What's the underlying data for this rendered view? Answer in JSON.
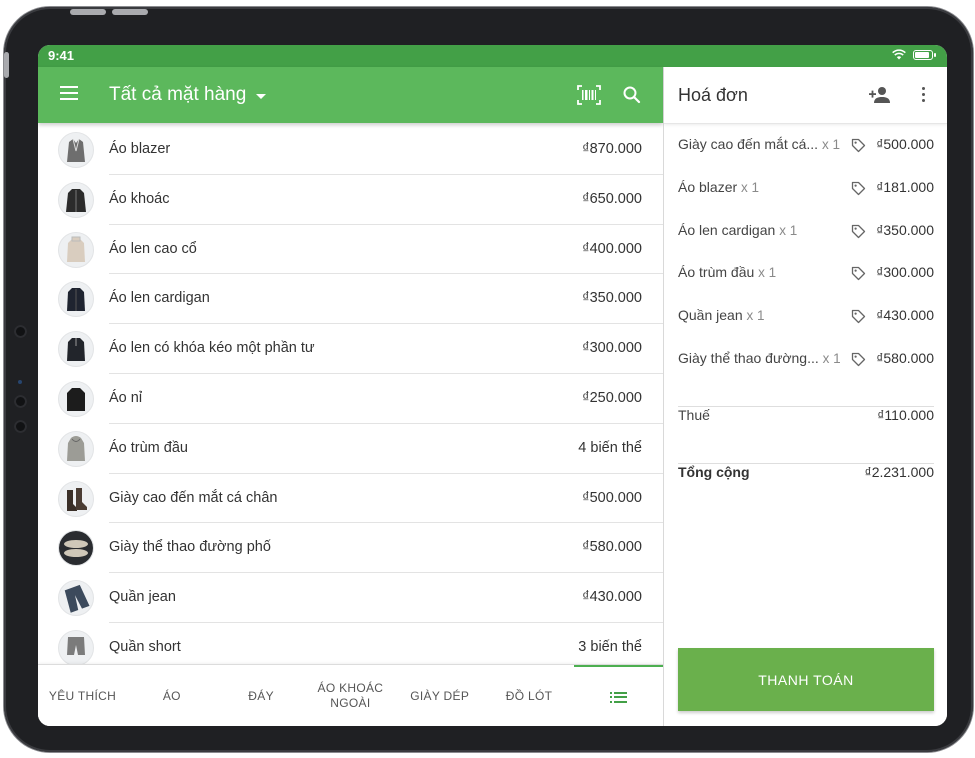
{
  "status_bar": {
    "time": "9:41",
    "battery_level": 0.9
  },
  "app_bar": {
    "title": "Tất cả mặt hàng",
    "icons": [
      "menu-icon",
      "chevron-down-icon",
      "barcode-scan-icon",
      "search-icon"
    ]
  },
  "items": [
    {
      "name": "Áo blazer",
      "price": "₫870.000",
      "icon": "blazer",
      "color": "#6e6e6e"
    },
    {
      "name": "Áo khoác",
      "price": "₫650.000",
      "icon": "jacket",
      "color": "#2b2b2b"
    },
    {
      "name": "Áo len cao cổ",
      "price": "₫400.000",
      "icon": "sweater",
      "color": "#d9cdbf"
    },
    {
      "name": "Áo len cardigan",
      "price": "₫350.000",
      "icon": "cardigan",
      "color": "#1f2430"
    },
    {
      "name": "Áo len có khóa kéo một phần tư",
      "price": "₫300.000",
      "icon": "zip-sweater",
      "color": "#22252b"
    },
    {
      "name": "Áo nỉ",
      "price": "₫250.000",
      "icon": "sweatshirt",
      "color": "#1c1c1c"
    },
    {
      "name": "Áo trùm đầu",
      "price": "4 biến thể",
      "icon": "hoodie",
      "color": "#9c9c96"
    },
    {
      "name": "Giày cao đến mắt cá chân",
      "price": "₫500.000",
      "icon": "boots",
      "color": "#3a2f28"
    },
    {
      "name": "Giày thể thao đường phố",
      "price": "₫580.000",
      "icon": "sneakers",
      "color": "#cfc7b8"
    },
    {
      "name": "Quần jean",
      "price": "₫430.000",
      "icon": "jeans",
      "color": "#3c4a5c"
    },
    {
      "name": "Quần short",
      "price": "3 biến thể",
      "icon": "shorts",
      "color": "#7b7b7b"
    }
  ],
  "tabs": [
    {
      "label": "YÊU THÍCH"
    },
    {
      "label": "ÁO"
    },
    {
      "label": "ĐÁY"
    },
    {
      "label": "ÁO KHOÁC NGOÀI"
    },
    {
      "label": "GIÀY DÉP"
    },
    {
      "label": "ĐỒ LÓT"
    },
    {
      "label": "",
      "icon": "list-icon",
      "active": true
    }
  ],
  "invoice": {
    "title": "Hoá đơn",
    "icons": [
      "add-customer-icon",
      "more-vert-icon"
    ],
    "lines": [
      {
        "name": "Giày cao đến mắt cá...",
        "qty": "x 1",
        "price": "₫500.000"
      },
      {
        "name": "Áo blazer",
        "qty": "x 1",
        "price": "₫181.000"
      },
      {
        "name": "Áo len cardigan",
        "qty": "x 1",
        "price": "₫350.000"
      },
      {
        "name": "Áo trùm đầu",
        "qty": "x 1",
        "price": "₫300.000"
      },
      {
        "name": "Quần jean",
        "qty": "x 1",
        "price": "₫430.000"
      },
      {
        "name": "Giày thể thao đường...",
        "qty": "x 1",
        "price": "₫580.000"
      }
    ],
    "tax_label": "Thuế",
    "tax_value": "₫110.000",
    "total_label": "Tổng cộng",
    "total_value": "₫2.231.000",
    "pay_button": "THANH TOÁN"
  },
  "colors": {
    "primary": "#5cb85c",
    "status_bar": "#43a047",
    "pay_button": "#6ab04c",
    "accent": "#4caf50"
  }
}
